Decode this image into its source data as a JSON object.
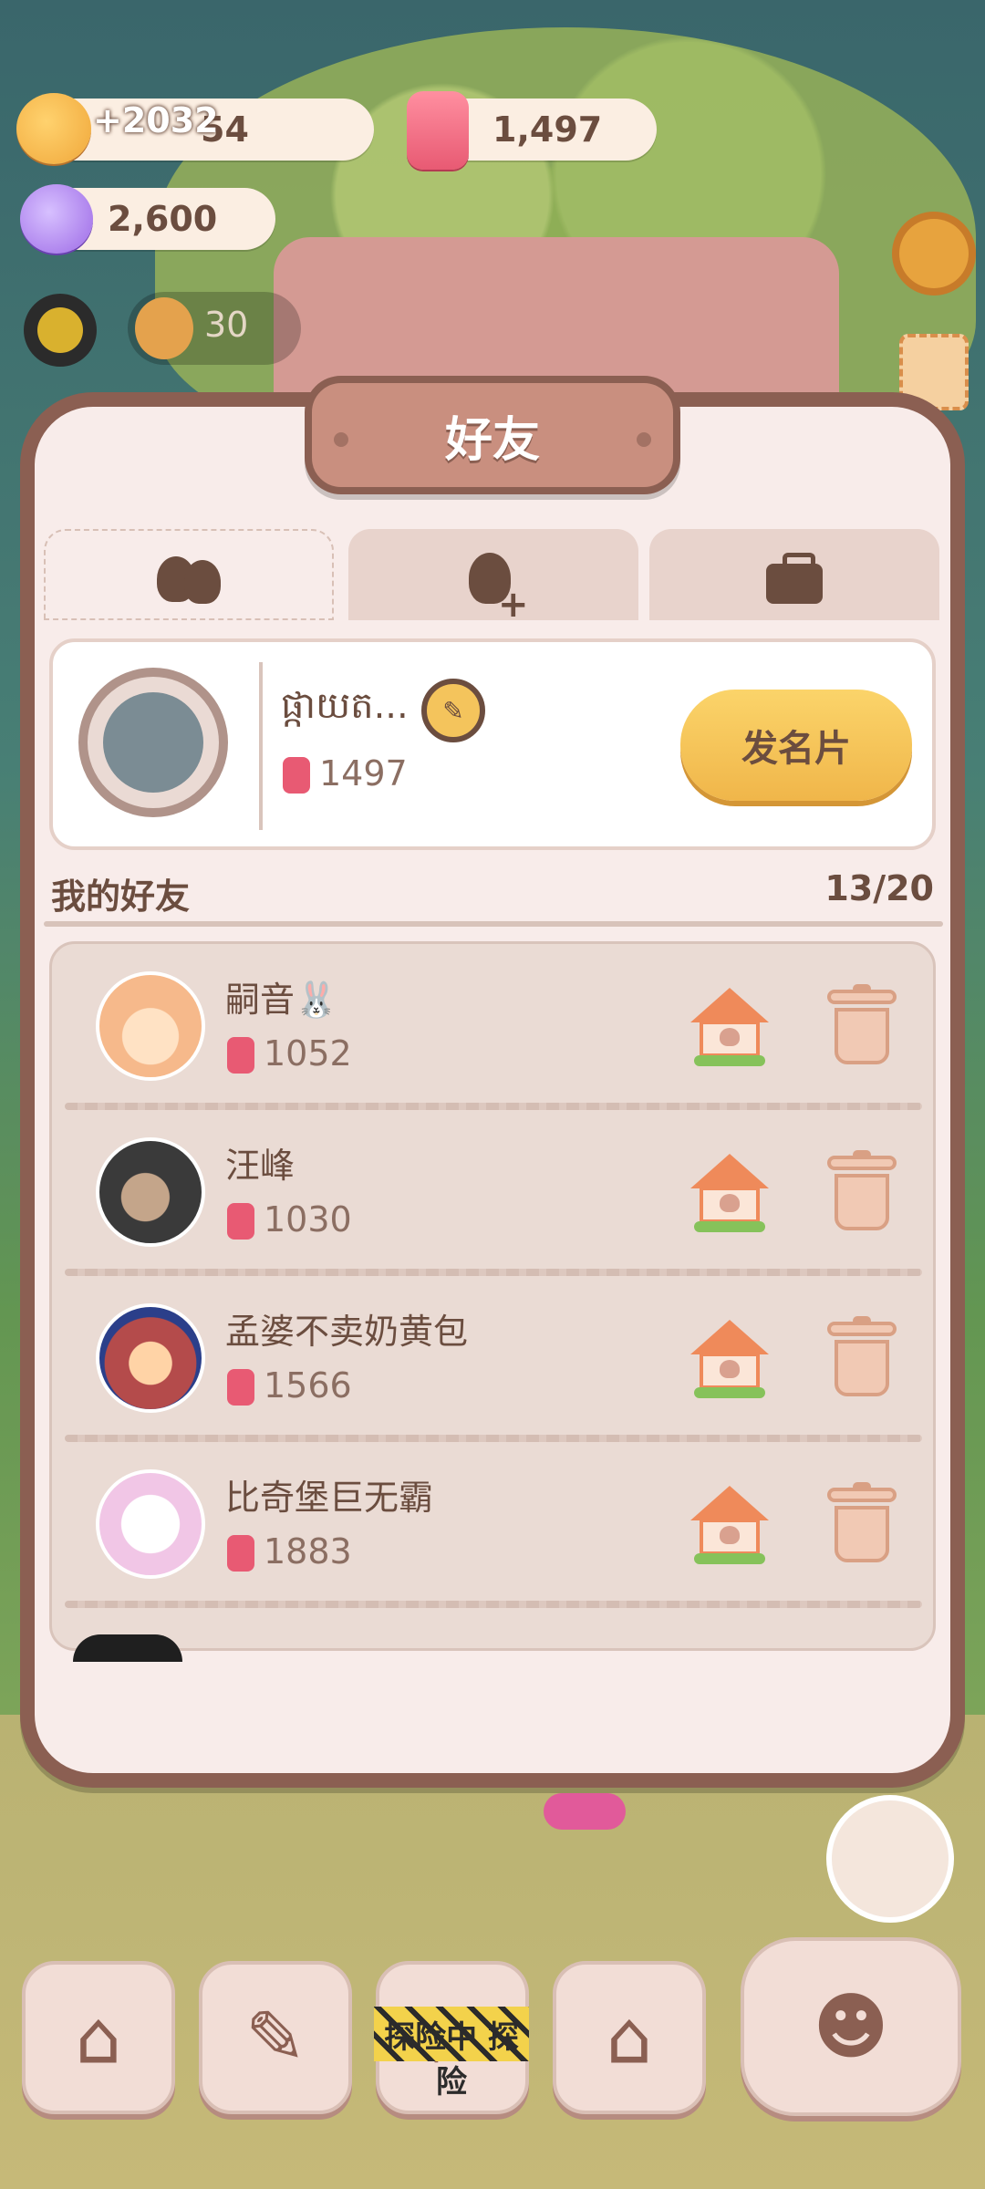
{
  "resources": {
    "coins_plus": "+2032",
    "coins_tail": "54",
    "candles": "1,497",
    "candy": "2,600",
    "cookies": "30"
  },
  "panel": {
    "title": "好友",
    "tabs": [
      {
        "name": "friends-tab",
        "icon": "friends-icon"
      },
      {
        "name": "add-friend-tab",
        "icon": "add-friend-icon"
      },
      {
        "name": "briefcase-tab",
        "icon": "briefcase-icon"
      }
    ],
    "profile": {
      "name": "ផ្កាយត...",
      "score": "1497",
      "send_card_label": "发名片"
    },
    "friends_section": {
      "title": "我的好友",
      "count": "13/20"
    },
    "friends": [
      {
        "name": "嗣音🐰",
        "score": "1052",
        "avatar_color": "#f6b98b"
      },
      {
        "name": "汪峰",
        "score": "1030",
        "avatar_color": "#7a6a63"
      },
      {
        "name": "孟婆不卖奶黄包",
        "score": "1566",
        "avatar_color": "#b44b4b"
      },
      {
        "name": "比奇堡巨无霸",
        "score": "1883",
        "avatar_color": "#f1dff0"
      }
    ]
  },
  "bottom_nav": {
    "banner_text": "探险中 探险"
  },
  "colors": {
    "panel_border": "#8b5f52",
    "accent_button": "#f4c45c",
    "text_brown": "#6b4d3f"
  }
}
